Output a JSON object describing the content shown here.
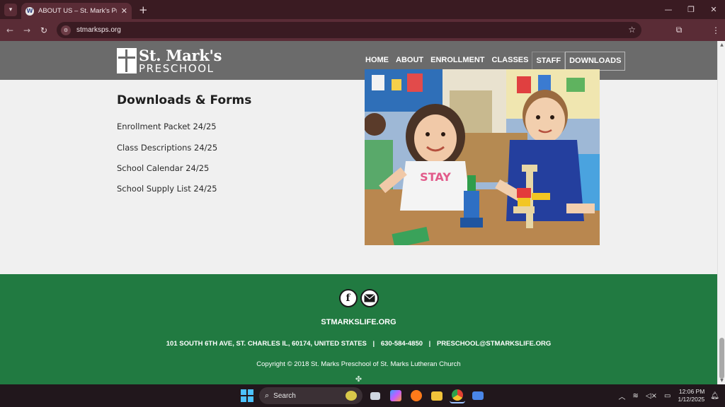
{
  "browser": {
    "tab_title": "ABOUT US – St. Mark's Preschool",
    "tab_favicon_glyph": "W",
    "url": "stmarksps.org",
    "icons": [
      "tab-list-icon",
      "back-icon",
      "forward-icon",
      "reload-icon",
      "site-info-icon",
      "star-icon",
      "extensions-icon",
      "profile-icon",
      "menu-icon"
    ]
  },
  "site": {
    "logo_line1": "St. Mark's",
    "logo_line2": "PRESCHOOL",
    "nav": [
      "HOME",
      "ABOUT",
      "ENROLLMENT",
      "CLASSES",
      "STAFF",
      "DOWNLOADS"
    ]
  },
  "content": {
    "heading": "Downloads & Forms",
    "links": [
      "Enrollment Packet 24/25",
      "Class Descriptions 24/25",
      "School Calendar 24/25",
      "School Supply List 24/25"
    ]
  },
  "footer": {
    "social": [
      "facebook-icon",
      "email-icon"
    ],
    "website": "STMARKSLIFE.ORG",
    "address": "101 SOUTH 6TH AVE, ST. CHARLES IL, 60174, UNITED STATES",
    "phone": "630-584-4850",
    "email": "PRESCHOOL@STMARKSLIFE.ORG",
    "separator": "|",
    "copyright": "Copyright © 2018 St. Marks Preschool of  St. Marks Lutheran Church"
  },
  "taskbar": {
    "search_label": "Search",
    "time": "12:06 PM",
    "date": "1/12/2025"
  },
  "colors": {
    "header_gray": "#6b6b6b",
    "footer_green": "#217a41",
    "browser_maroon": "#5a2c36"
  }
}
